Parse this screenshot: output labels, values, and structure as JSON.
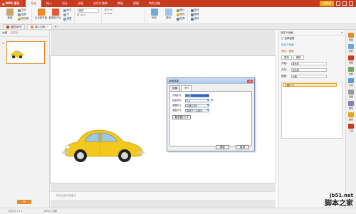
{
  "app": {
    "name": "WPS 演示"
  },
  "tabs": [
    "开始",
    "插入",
    "设计",
    "动画",
    "幻灯片放映",
    "审阅",
    "视图",
    "特色功能"
  ],
  "titlebar": {
    "login": "未登录"
  },
  "ribbon": {
    "paste": "粘贴",
    "cut": "剪切",
    "copy": "复制",
    "format_painter": "格式刷",
    "from_current": "从当前开始",
    "new_slide": "新建幻灯片",
    "layout": "版式",
    "section": "节",
    "reset": "重置",
    "font": "宋体",
    "shape": "形状",
    "arrange": "排列",
    "picture": "图片",
    "fill": "填充",
    "outline": "轮廓",
    "find": "查找",
    "replace": "替换",
    "select": "选择"
  },
  "doctabs": [
    {
      "label": "我的WPS"
    },
    {
      "label": "演示文稿1 *"
    }
  ],
  "leftpane": {
    "tab_outline": "大纲",
    "tab_slides": "幻灯片",
    "slide_number": "1"
  },
  "notes": {
    "placeholder": "单击此处添加备注"
  },
  "dialog": {
    "title": "疾驰效果",
    "tab_effect": "效果",
    "tab_timing": "计时",
    "start_label": "开始(S):",
    "start_value": "之前",
    "delay_label": "延迟(D):",
    "delay_value": "0.0",
    "delay_unit": "秒",
    "speed_label": "速度(E):",
    "speed_value": "中速(2 秒)",
    "repeat_label": "重复(R):",
    "repeat_value": "直到下一次单击",
    "trigger_btn": "触发器(T) ¥",
    "ok": "确定",
    "cancel": "取消"
  },
  "rightpane": {
    "title": "自定义动画",
    "select_pane": "选择窗格",
    "custom_anim": "自定义动画",
    "modify_label": "修改：疾驰",
    "change_btn": "更改",
    "delete_btn": "删除",
    "start_label": "开始：",
    "start_value": "单击时",
    "direction_label": "方向：",
    "direction_value": "自右侧",
    "speed_label": "速度：",
    "speed_value": "中速",
    "item": "1 图片 8"
  },
  "vbar": [
    "新建",
    "形状",
    "动画",
    "切换",
    "分享",
    "选择",
    "属性",
    "备份",
    "工具"
  ],
  "statusbar": {
    "slide": "幻灯片 1 / 1",
    "theme": "Office 主题"
  },
  "watermark": {
    "line1": "jb51.net",
    "line2": "脚本之家"
  },
  "colors": {
    "accent": "#c83a1f",
    "car": "#f2c81c",
    "login": "#e8a51d"
  }
}
